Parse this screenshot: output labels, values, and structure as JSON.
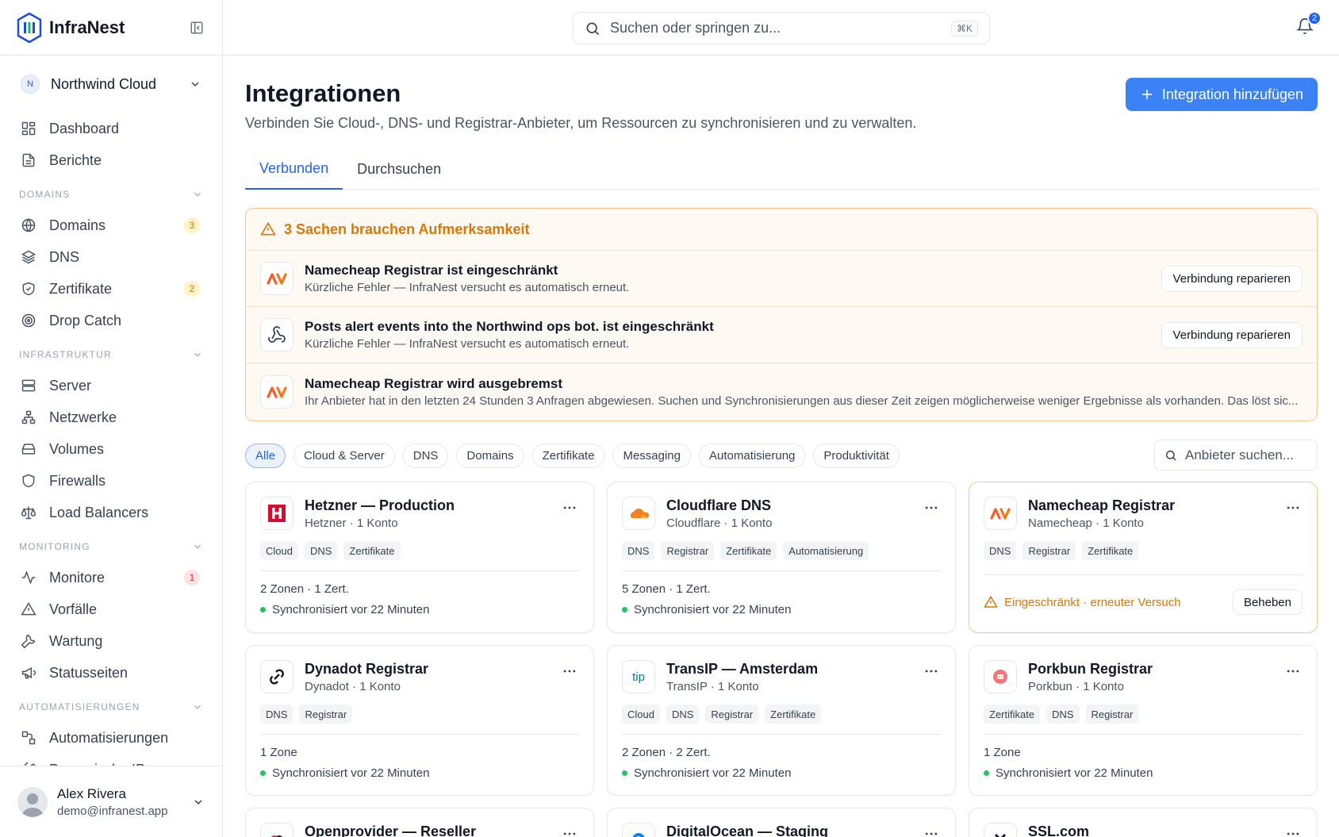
{
  "app": {
    "name": "InfraNest"
  },
  "org": {
    "initial": "N",
    "name": "Northwind Cloud"
  },
  "nav": {
    "top": [
      {
        "label": "Dashboard",
        "icon": "dashboard-icon"
      },
      {
        "label": "Berichte",
        "icon": "report-icon"
      }
    ],
    "sections": [
      {
        "title": "DOMAINS",
        "items": [
          {
            "label": "Domains",
            "icon": "globe-icon",
            "badge": "3"
          },
          {
            "label": "DNS",
            "icon": "layers-icon"
          },
          {
            "label": "Zertifikate",
            "icon": "shield-check-icon",
            "badge": "2"
          },
          {
            "label": "Drop Catch",
            "icon": "target-icon"
          }
        ]
      },
      {
        "title": "INFRASTRUKTUR",
        "items": [
          {
            "label": "Server",
            "icon": "server-icon"
          },
          {
            "label": "Netzwerke",
            "icon": "network-icon"
          },
          {
            "label": "Volumes",
            "icon": "volume-icon"
          },
          {
            "label": "Firewalls",
            "icon": "shield-icon"
          },
          {
            "label": "Load Balancers",
            "icon": "scale-icon"
          }
        ]
      },
      {
        "title": "MONITORING",
        "items": [
          {
            "label": "Monitore",
            "icon": "activity-icon",
            "badge": "1"
          },
          {
            "label": "Vorfälle",
            "icon": "alert-triangle-icon"
          },
          {
            "label": "Wartung",
            "icon": "wrench-icon"
          },
          {
            "label": "Statusseiten",
            "icon": "megaphone-icon"
          }
        ]
      },
      {
        "title": "AUTOMATISIERUNGEN",
        "items": [
          {
            "label": "Automatisierungen",
            "icon": "workflow-icon"
          },
          {
            "label": "Dynamische IPs",
            "icon": "dynamic-ip-icon"
          }
        ]
      }
    ]
  },
  "user": {
    "name": "Alex Rivera",
    "email": "demo@infranest.app"
  },
  "topbar": {
    "search_placeholder": "Suchen oder springen zu...",
    "shortcut": "⌘K",
    "notifications": "2"
  },
  "page": {
    "title": "Integrationen",
    "subtitle": "Verbinden Sie Cloud-, DNS- und Registrar-Anbieter, um Ressourcen zu synchronisieren und zu verwalten.",
    "add_button": "Integration hinzufügen",
    "tabs": [
      "Verbunden",
      "Durchsuchen"
    ]
  },
  "attention": {
    "title": "3 Sachen brauchen Aufmerksamkeit",
    "items": [
      {
        "title": "Namecheap Registrar ist eingeschränkt",
        "desc": "Kürzliche Fehler — InfraNest versucht es automatisch erneut.",
        "action": "Verbindung reparieren",
        "logo": "namecheap-logo"
      },
      {
        "title": "Posts alert events into the Northwind ops bot. ist eingeschränkt",
        "desc": "Kürzliche Fehler — InfraNest versucht es automatisch erneut.",
        "action": "Verbindung reparieren",
        "logo": "webhook-logo"
      },
      {
        "title": "Namecheap Registrar wird ausgebremst",
        "desc": "Ihr Anbieter hat in den letzten 24 Stunden 3 Anfragen abgewiesen. Suchen und Synchronisierungen aus dieser Zeit zeigen möglicherweise weniger Ergebnisse als vorhanden. Das löst sic...",
        "logo": "namecheap-logo"
      }
    ]
  },
  "filters": {
    "chips": [
      "Alle",
      "Cloud & Server",
      "DNS",
      "Domains",
      "Zertifikate",
      "Messaging",
      "Automatisierung",
      "Produktivität"
    ],
    "active": "Alle",
    "search_placeholder": "Anbieter suchen..."
  },
  "cards": [
    {
      "title": "Hetzner — Production",
      "sub": "Hetzner · 1 Konto",
      "tags": [
        "Cloud",
        "DNS",
        "Zertifikate"
      ],
      "stats": "2 Zonen · 1 Zert.",
      "sync": "Synchronisiert vor 22 Minuten",
      "logo": "hetzner-logo"
    },
    {
      "title": "Cloudflare DNS",
      "sub": "Cloudflare · 1 Konto",
      "tags": [
        "DNS",
        "Registrar",
        "Zertifikate",
        "Automatisierung"
      ],
      "stats": "5 Zonen · 1 Zert.",
      "sync": "Synchronisiert vor 22 Minuten",
      "logo": "cloudflare-logo"
    },
    {
      "title": "Namecheap Registrar",
      "sub": "Namecheap · 1 Konto",
      "tags": [
        "DNS",
        "Registrar",
        "Zertifikate"
      ],
      "warning": "Eingeschränkt · erneuter Versuch",
      "action": "Beheben",
      "logo": "namecheap-logo"
    },
    {
      "title": "Dynadot Registrar",
      "sub": "Dynadot · 1 Konto",
      "tags": [
        "DNS",
        "Registrar"
      ],
      "stats": "1 Zone",
      "sync": "Synchronisiert vor 22 Minuten",
      "logo": "dynadot-logo"
    },
    {
      "title": "TransIP — Amsterdam",
      "sub": "TransIP · 1 Konto",
      "tags": [
        "Cloud",
        "DNS",
        "Registrar",
        "Zertifikate"
      ],
      "stats": "2 Zonen · 2 Zert.",
      "sync": "Synchronisiert vor 22 Minuten",
      "logo": "transip-logo",
      "logo_text": "tip"
    },
    {
      "title": "Porkbun Registrar",
      "sub": "Porkbun · 1 Konto",
      "tags": [
        "Zertifikate",
        "DNS",
        "Registrar"
      ],
      "stats": "1 Zone",
      "sync": "Synchronisiert vor 22 Minuten",
      "logo": "porkbun-logo"
    },
    {
      "title": "Openprovider — Reseller",
      "logo": "openprovider-logo"
    },
    {
      "title": "DigitalOcean — Staging",
      "logo": "digitalocean-logo"
    },
    {
      "title": "SSL.com",
      "logo": "sslcom-logo"
    }
  ]
}
